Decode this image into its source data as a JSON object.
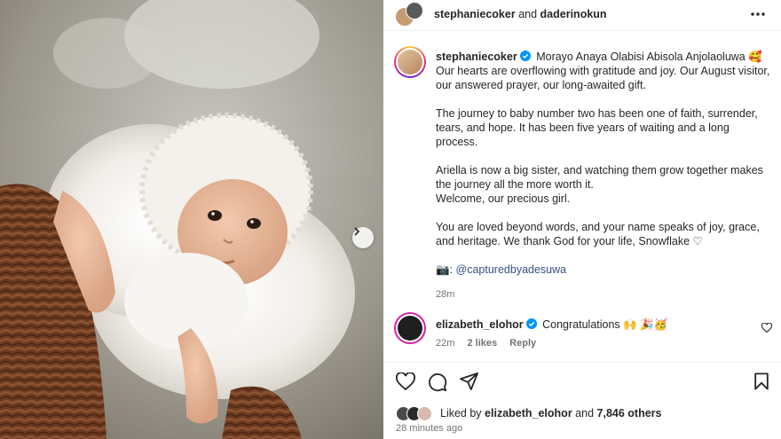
{
  "header": {
    "user1": "stephaniecoker",
    "conj": "and",
    "user2": "daderinokun"
  },
  "caption": {
    "username": "stephaniecoker",
    "line1": "Morayo Anaya Olabisi Abisola Anjolaoluwa 🥰",
    "line1_rest": "Our hearts are overflowing with gratitude and joy. Our August visitor, our answered prayer, our long-awaited gift.",
    "p2": "The journey to baby number two has been one of faith, surrender, tears, and hope. It has been five years of waiting and a long process.",
    "p3a": "Ariella is now a big sister, and watching them grow together makes the journey all the more worth it.",
    "p3b": "Welcome, our precious girl.",
    "p4": "You are loved beyond words, and your name speaks of joy, grace, and heritage. We thank God for your life, Snowflake ♡",
    "credit_prefix": "📷:",
    "credit_mention": "@capturedbyadesuwa",
    "time": "28m"
  },
  "comment": {
    "username": "elizabeth_elohor",
    "text": "Congratulations 🙌 🎉🥳",
    "time": "22m",
    "likes": "2 likes",
    "reply": "Reply"
  },
  "likes": {
    "prefix": "Liked by",
    "user": "elizabeth_elohor",
    "mid": "and",
    "count": "7,846 others"
  },
  "posted_ago": "28 minutes ago",
  "icons": {
    "more": "more-options-icon",
    "next": "chevron-right-icon",
    "like": "heart-icon",
    "comment": "comment-icon",
    "share": "send-icon",
    "save": "bookmark-icon"
  },
  "colors": {
    "verified": "#0095f6",
    "mention": "#385185",
    "secondary_text": "#737373"
  }
}
